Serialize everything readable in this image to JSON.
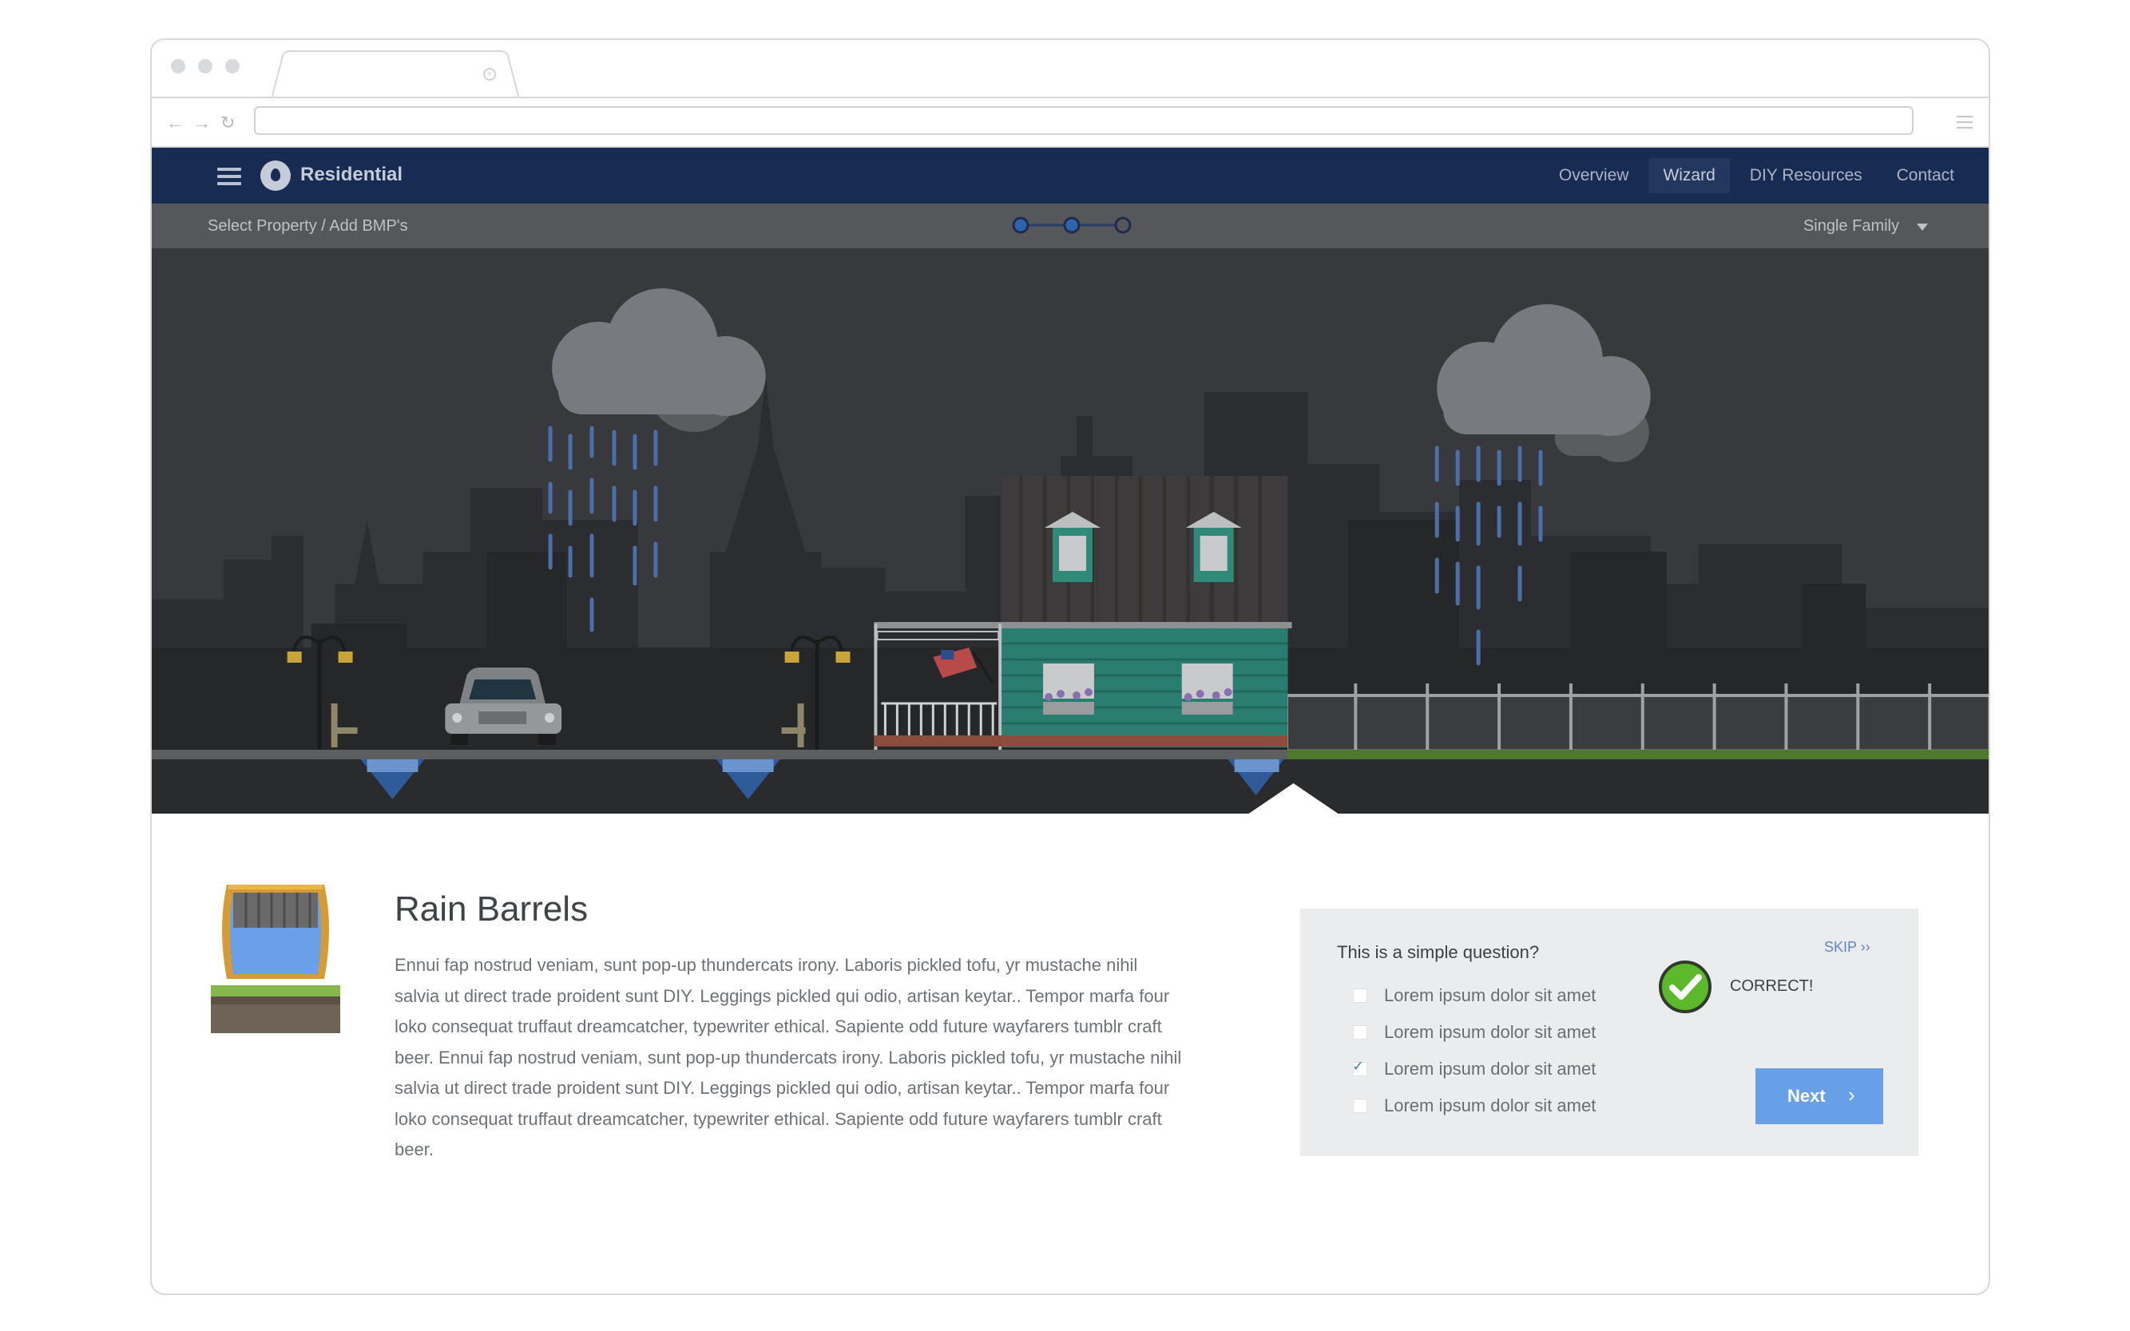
{
  "app": {
    "brand": "Residential",
    "nav": [
      "Overview",
      "Wizard",
      "DIY Resources",
      "Contact"
    ],
    "active_nav": "Wizard"
  },
  "subbar": {
    "breadcrumb": "Select Property / Add BMP's",
    "steps_total": 3,
    "steps_completed": 2,
    "property_type": "Single Family"
  },
  "content": {
    "title": "Rain Barrels",
    "body": "Ennui fap nostrud veniam, sunt pop-up thundercats irony. Laboris pickled tofu, yr mustache nihil salvia ut direct trade proident sunt DIY. Leggings pickled qui odio, artisan keytar.. Tempor marfa four loko consequat truffaut dreamcatcher, typewriter ethical. Sapiente odd future wayfarers tumblr craft beer.  Ennui fap nostrud veniam, sunt pop-up thundercats irony. Laboris pickled tofu, yr mustache nihil salvia ut direct trade proident sunt DIY. Leggings pickled qui odio, artisan keytar.. Tempor marfa four loko consequat truffaut dreamcatcher, typewriter ethical. Sapiente odd future wayfarers tumblr craft beer."
  },
  "quiz": {
    "question": "This is a simple question?",
    "skip": "SKIP ››",
    "options": [
      {
        "label": "Lorem ipsum dolor sit amet",
        "checked": false
      },
      {
        "label": "Lorem ipsum dolor sit amet",
        "checked": false
      },
      {
        "label": "Lorem ipsum dolor sit amet",
        "checked": true
      },
      {
        "label": "Lorem ipsum dolor sit amet",
        "checked": false
      }
    ],
    "result": "CORRECT!",
    "next": "Next"
  },
  "icons": {
    "back": "back-arrow-icon",
    "forward": "forward-arrow-icon",
    "reload": "reload-icon",
    "menu": "hamburger-menu-icon",
    "logo": "water-drop-icon",
    "dropdown": "chevron-down-icon",
    "check": "check-icon",
    "next": "chevron-right-icon"
  },
  "colors": {
    "header": "#182b52",
    "subbar": "#55575a",
    "accent": "#68a0e8",
    "correct": "#5cb92b"
  }
}
